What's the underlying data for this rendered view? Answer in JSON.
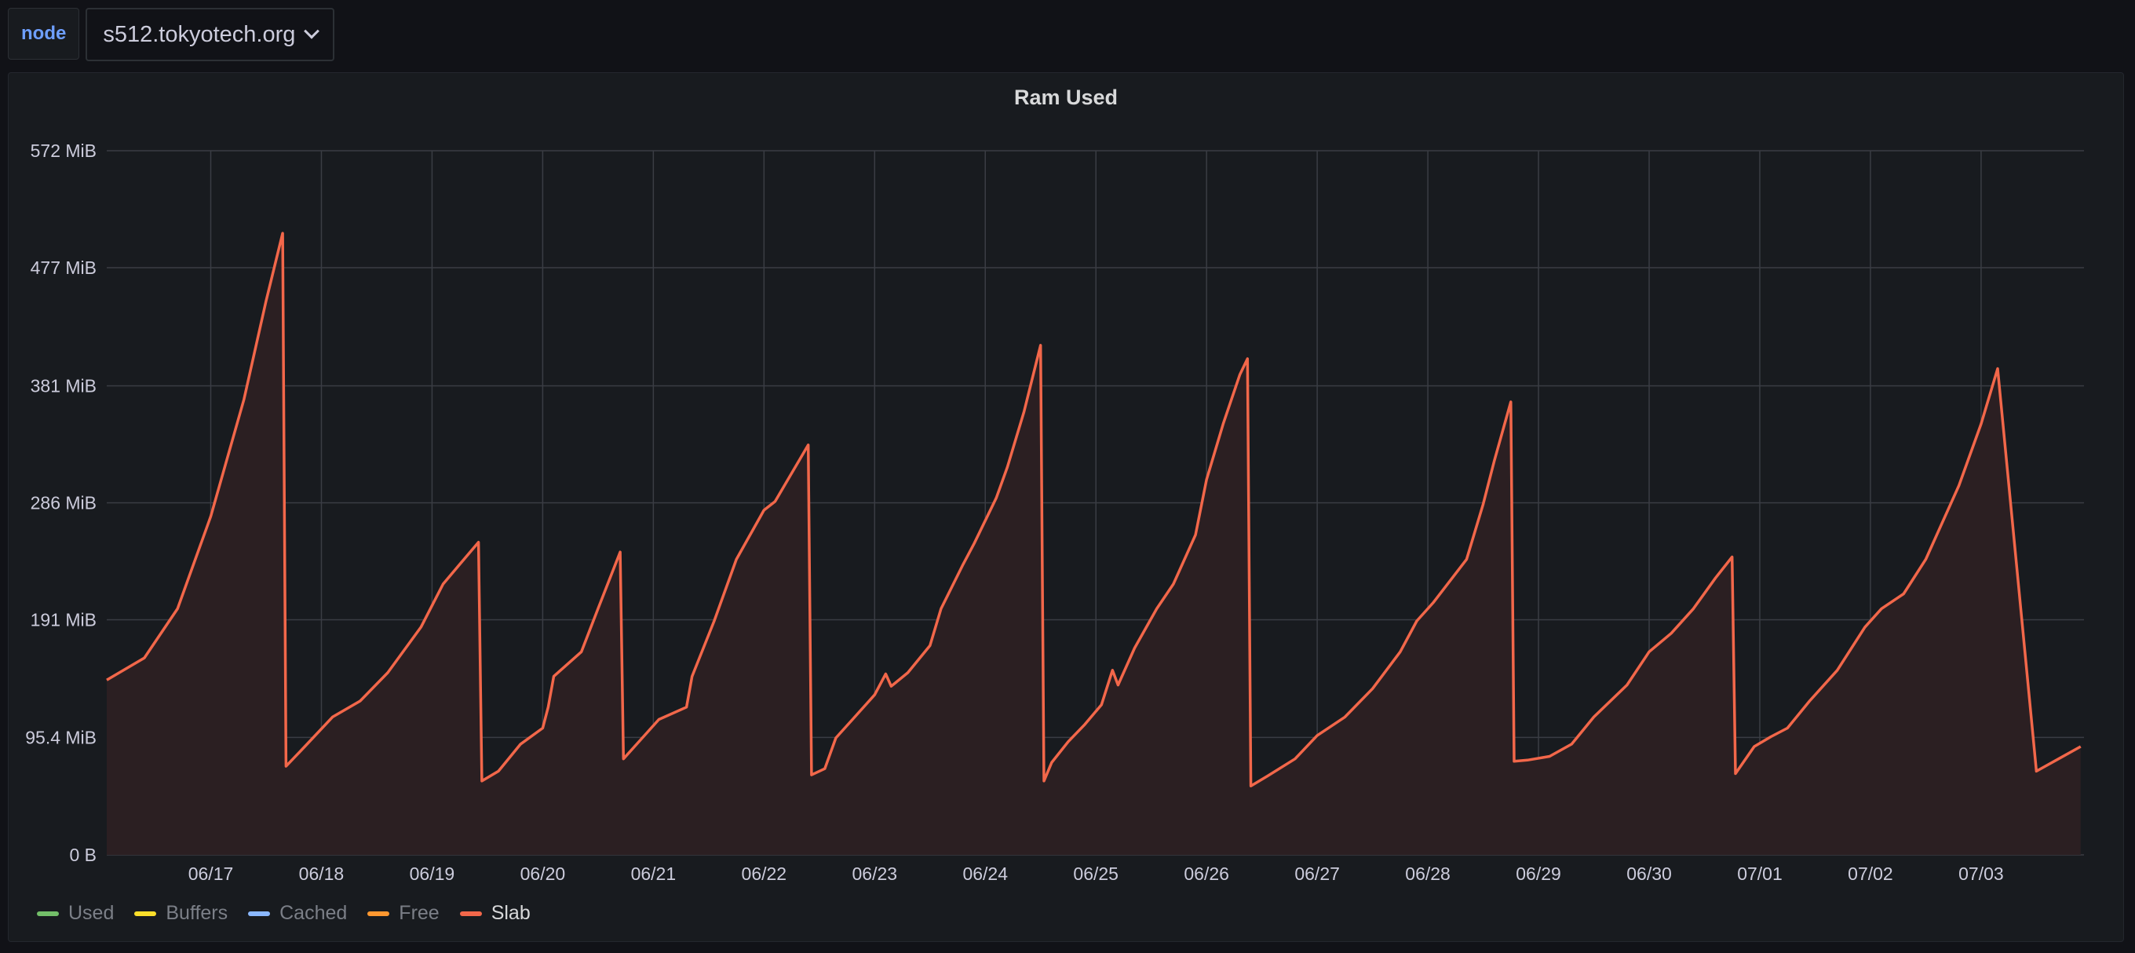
{
  "variable": {
    "label": "node",
    "value": "s512.tokyotech.org"
  },
  "panel": {
    "title": "Ram Used"
  },
  "legend": [
    {
      "name": "Used",
      "color": "#73bf69"
    },
    {
      "name": "Buffers",
      "color": "#fade2a"
    },
    {
      "name": "Cached",
      "color": "#8ab8ff"
    },
    {
      "name": "Free",
      "color": "#ff9830"
    },
    {
      "name": "Slab",
      "color": "#f2674a"
    }
  ],
  "chart_data": {
    "type": "area",
    "title": "Ram Used",
    "xlabel": "",
    "ylabel": "",
    "x_unit": "days",
    "xlim": [
      -0.93,
      7.93
    ],
    "x_ticks": [
      {
        "x": 0,
        "label": "06/17"
      },
      {
        "x": 1,
        "label": "06/18"
      },
      {
        "x": 2,
        "label": "06/19"
      },
      {
        "x": 3,
        "label": "06/20"
      },
      {
        "x": 4,
        "label": "06/21"
      },
      {
        "x": 5,
        "label": "06/22"
      },
      {
        "x": 6,
        "label": "06/23"
      },
      {
        "x": 7,
        "label": "06/24"
      },
      {
        "x": 8,
        "label": "06/25"
      },
      {
        "x": 9,
        "label": "06/26"
      },
      {
        "x": 10,
        "label": "06/27"
      },
      {
        "x": 11,
        "label": "06/28"
      },
      {
        "x": 12,
        "label": "06/29"
      },
      {
        "x": 13,
        "label": "06/30"
      },
      {
        "x": 14,
        "label": "07/01"
      },
      {
        "x": 15,
        "label": "07/02"
      },
      {
        "x": 16,
        "label": "07/03"
      }
    ],
    "ylim": [
      0,
      572
    ],
    "y_ticks": [
      {
        "value": 0,
        "label": "0 B"
      },
      {
        "value": 95.4,
        "label": "95.4 MiB"
      },
      {
        "value": 191,
        "label": "191 MiB"
      },
      {
        "value": 286,
        "label": "286 MiB"
      },
      {
        "value": 381,
        "label": "381 MiB"
      },
      {
        "value": 477,
        "label": "477 MiB"
      },
      {
        "value": 572,
        "label": "572 MiB"
      }
    ],
    "grid": true,
    "legend_position": "bottom-left",
    "series": [
      {
        "name": "Slab",
        "color": "#f2674a",
        "points": [
          [
            -0.94,
            142
          ],
          [
            -0.6,
            160
          ],
          [
            -0.3,
            200
          ],
          [
            0.0,
            275
          ],
          [
            0.3,
            370
          ],
          [
            0.5,
            450
          ],
          [
            0.65,
            505
          ],
          [
            0.68,
            72
          ],
          [
            0.85,
            88
          ],
          [
            1.1,
            112
          ],
          [
            1.35,
            125
          ],
          [
            1.6,
            148
          ],
          [
            1.9,
            185
          ],
          [
            2.1,
            220
          ],
          [
            2.25,
            236
          ],
          [
            2.42,
            254
          ],
          [
            2.45,
            60
          ],
          [
            2.6,
            68
          ],
          [
            2.8,
            90
          ],
          [
            3.0,
            103
          ],
          [
            3.05,
            120
          ],
          [
            3.1,
            145
          ],
          [
            3.35,
            165
          ],
          [
            3.5,
            200
          ],
          [
            3.7,
            246
          ],
          [
            3.73,
            78
          ],
          [
            3.9,
            95
          ],
          [
            4.05,
            110
          ],
          [
            4.3,
            120
          ],
          [
            4.35,
            145
          ],
          [
            4.55,
            190
          ],
          [
            4.75,
            240
          ],
          [
            5.0,
            280
          ],
          [
            5.1,
            287
          ],
          [
            5.4,
            333
          ],
          [
            5.43,
            65
          ],
          [
            5.55,
            70
          ],
          [
            5.65,
            95
          ],
          [
            5.8,
            110
          ],
          [
            6.0,
            130
          ],
          [
            6.1,
            147
          ],
          [
            6.15,
            137
          ],
          [
            6.3,
            148
          ],
          [
            6.5,
            170
          ],
          [
            6.6,
            200
          ],
          [
            6.8,
            236
          ],
          [
            6.9,
            253
          ],
          [
            7.1,
            290
          ],
          [
            7.2,
            315
          ],
          [
            7.35,
            360
          ],
          [
            7.5,
            414
          ],
          [
            7.53,
            60
          ],
          [
            7.6,
            75
          ],
          [
            7.75,
            92
          ],
          [
            7.9,
            106
          ],
          [
            8.05,
            122
          ],
          [
            8.1,
            136
          ],
          [
            8.15,
            150
          ],
          [
            8.2,
            138
          ],
          [
            8.35,
            168
          ],
          [
            8.55,
            200
          ],
          [
            8.7,
            220
          ],
          [
            8.9,
            260
          ],
          [
            9.0,
            305
          ],
          [
            9.15,
            350
          ],
          [
            9.3,
            390
          ],
          [
            9.37,
            403
          ],
          [
            9.4,
            56
          ],
          [
            9.55,
            64
          ],
          [
            9.8,
            78
          ],
          [
            10.0,
            97
          ],
          [
            10.25,
            112
          ],
          [
            10.5,
            135
          ],
          [
            10.75,
            165
          ],
          [
            10.9,
            190
          ],
          [
            11.05,
            205
          ],
          [
            11.35,
            240
          ],
          [
            11.5,
            285
          ],
          [
            11.6,
            320
          ],
          [
            11.75,
            368
          ],
          [
            11.78,
            76
          ],
          [
            11.9,
            77
          ],
          [
            12.1,
            80
          ],
          [
            12.3,
            90
          ],
          [
            12.5,
            112
          ],
          [
            12.8,
            138
          ],
          [
            13.0,
            165
          ],
          [
            13.2,
            180
          ],
          [
            13.4,
            200
          ],
          [
            13.6,
            225
          ],
          [
            13.75,
            242
          ],
          [
            13.78,
            66
          ],
          [
            13.95,
            88
          ],
          [
            14.1,
            96
          ],
          [
            14.25,
            103
          ],
          [
            14.45,
            125
          ],
          [
            14.7,
            150
          ],
          [
            14.95,
            185
          ],
          [
            15.1,
            200
          ],
          [
            15.3,
            212
          ],
          [
            15.5,
            240
          ],
          [
            15.8,
            300
          ],
          [
            16.0,
            350
          ],
          [
            16.15,
            395
          ],
          [
            16.5,
            68
          ],
          [
            16.7,
            78
          ],
          [
            16.9,
            88
          ]
        ]
      }
    ]
  }
}
